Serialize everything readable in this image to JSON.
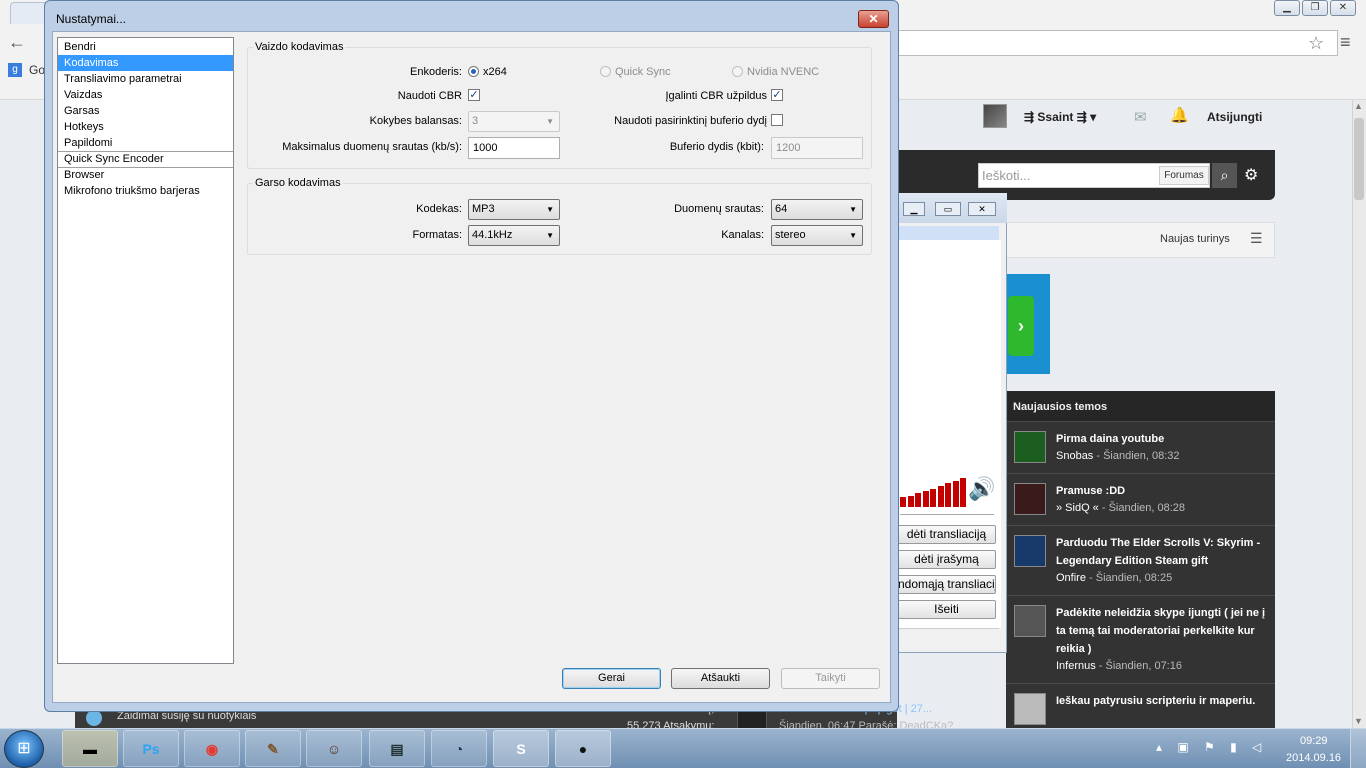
{
  "browser": {
    "bookmark_label": "Go",
    "google_letter": "g"
  },
  "site": {
    "user": {
      "name": "⇶ Ssaint ⇶ ▾",
      "logout": "Atsijungti"
    },
    "search": {
      "placeholder": "Ieškoti...",
      "scope": "Forumas"
    },
    "new_content": "Naujas turinys",
    "panel_title": "Naujausios temos",
    "topics": [
      {
        "title": "Pirma daina youtube",
        "author": "Snobas",
        "time": " - Šiandien, 08:32"
      },
      {
        "title": "Pramuse :DD",
        "author": "» SidQ «",
        "time": " - Šiandien, 08:28"
      },
      {
        "title": "Parduodu The Elder Scrolls V: Skyrim - Legendary Edition Steam gift",
        "author": "Onfire",
        "time": " - Šiandien, 08:25"
      },
      {
        "title": "Padėkite neleidžia skype ijungti ( jei ne į ta temą tai moderatoriai perkelkite kur reikia )",
        "author": "Infernus",
        "time": " - Šiandien, 07:16"
      },
      {
        "title": "Ieškau patyrusiu scripteriu ir maperiu.",
        "author": "",
        "time": ""
      }
    ],
    "bottom": {
      "text": "Žaidimai susiję su nuotykiais",
      "num1": "6.303 Temų;",
      "num2": "55.273 Atsakymų;",
      "link": "MC.LTCRAFT.LT | Spigot | 27...",
      "link2": "Šiandien, 06:47 Parašė: DeadCKa?"
    }
  },
  "obs": {
    "buttons": [
      "dėti transliaciją",
      "dėti įrašymą",
      "ndomąją transliaciją",
      "Išeiti"
    ],
    "meter_levels": [
      0.3,
      0.35,
      0.45,
      0.5,
      0.55,
      0.65,
      0.75,
      0.8,
      0.9
    ]
  },
  "dialog": {
    "title": "Nustatymai...",
    "close_glyph": "✕",
    "nav": [
      "Bendri",
      "Kodavimas",
      "Transliavimo parametrai",
      "Vaizdas",
      "Garsas",
      "Hotkeys",
      "Papildomi",
      "Quick Sync Encoder",
      "Browser",
      "Mikrofono triukšmo barjeras"
    ],
    "video": {
      "group": "Vaizdo kodavimas",
      "encoder_label": "Enkoderis:",
      "enc_x264": "x264",
      "enc_qsv": "Quick Sync",
      "enc_nvenc": "Nvidia NVENC",
      "cbr_label": "Naudoti CBR",
      "cbr_fill_label": "Įgalinti CBR užpildus",
      "quality_label": "Kokybes balansas:",
      "quality_value": "3",
      "custom_buffer_label": "Naudoti pasirinktinį buferio dydį",
      "bitrate_label": "Maksimalus duomenų srautas (kb/s):",
      "bitrate_value": "1000",
      "buffer_label": "Buferio dydis (kbit):",
      "buffer_value": "1200"
    },
    "audio": {
      "group": "Garso kodavimas",
      "codec_label": "Kodekas:",
      "codec_value": "MP3",
      "bitrate_label": "Duomenų srautas:",
      "bitrate_value": "64",
      "format_label": "Formatas:",
      "format_value": "44.1kHz",
      "channel_label": "Kanalas:",
      "channel_value": "stereo"
    },
    "buttons": {
      "ok": "Gerai",
      "cancel": "Atšaukti",
      "apply": "Taikyti"
    }
  },
  "taskbar": {
    "time": "09:29",
    "date": "2014.09.16",
    "apps": [
      "Ps",
      "◉",
      "✎",
      "☺",
      "▤",
      "◔",
      "S",
      "●"
    ]
  }
}
